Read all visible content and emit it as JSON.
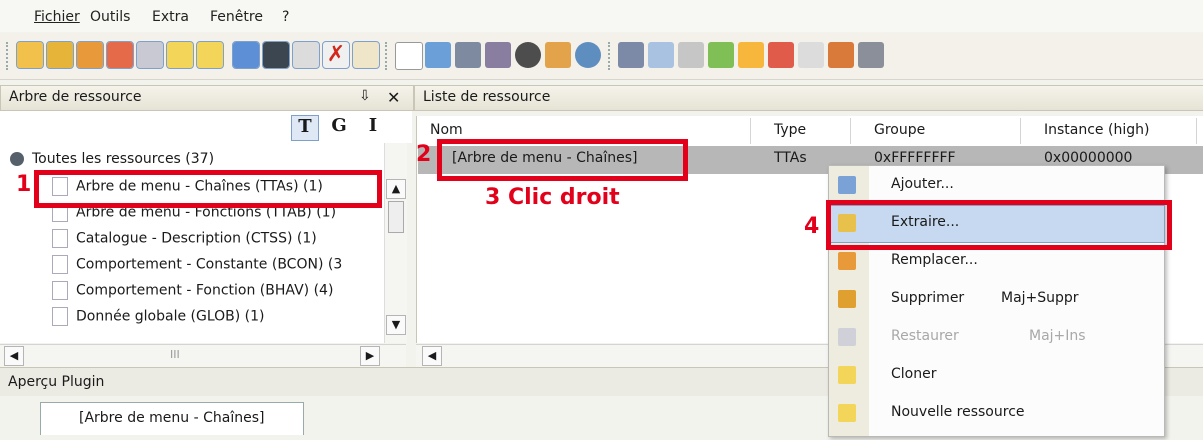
{
  "menu": [
    "Fichier",
    "Outils",
    "Extra",
    "Fenêtre",
    "?"
  ],
  "left_panel": {
    "title": "Arbre de ressource",
    "pin": "⇩",
    "close": "✕",
    "tgi": [
      "T",
      "G",
      "I"
    ],
    "root": "Toutes les ressources (37)",
    "items": [
      "Arbre de menu - Chaînes (TTAs) (1)",
      "Arbre de menu - Fonctions (TTAB) (1)",
      "Catalogue - Description (CTSS) (1)",
      "Comportement - Constante (BCON) (3",
      "Comportement - Fonction (BHAV) (4)",
      "Donnée globale (GLOB) (1)"
    ],
    "hscroll_mark": "III"
  },
  "list_panel": {
    "title": "Liste de ressource",
    "columns": [
      "Nom",
      "Type",
      "Groupe",
      "Instance (high)"
    ],
    "row": {
      "nom": "[Arbre de menu - Chaînes]",
      "type": "TTAs",
      "groupe": "0xFFFFFFFF",
      "instance": "0x00000000"
    }
  },
  "annotations": {
    "n1": "1",
    "n2": "2",
    "n3": "3 Clic droit",
    "n4": "4"
  },
  "context_menu": [
    {
      "label": "Ajouter...",
      "shortcut": "",
      "enabled": true,
      "icon": "add-icon"
    },
    {
      "label": "Extraire...",
      "shortcut": "",
      "enabled": true,
      "icon": "extract-icon"
    },
    {
      "label": "Remplacer...",
      "shortcut": "",
      "enabled": true,
      "icon": "replace-icon"
    },
    {
      "label": "Supprimer",
      "shortcut": "Maj+Suppr",
      "enabled": true,
      "icon": "delete-icon"
    },
    {
      "label": "Restaurer",
      "shortcut": "Maj+Ins",
      "enabled": false,
      "icon": "restore-icon"
    },
    {
      "label": "Cloner",
      "shortcut": "",
      "enabled": true,
      "icon": "clone-icon"
    },
    {
      "label": "Nouvelle ressource",
      "shortcut": "",
      "enabled": true,
      "icon": "new-resource-icon"
    }
  ],
  "preview": {
    "title": "Aperçu Plugin",
    "tab": "[Arbre de menu - Chaînes]"
  },
  "colors": {
    "accent_red": "#e3001b",
    "selection": "#b7b7b7",
    "menu_highlight": "#c7d9f1"
  }
}
